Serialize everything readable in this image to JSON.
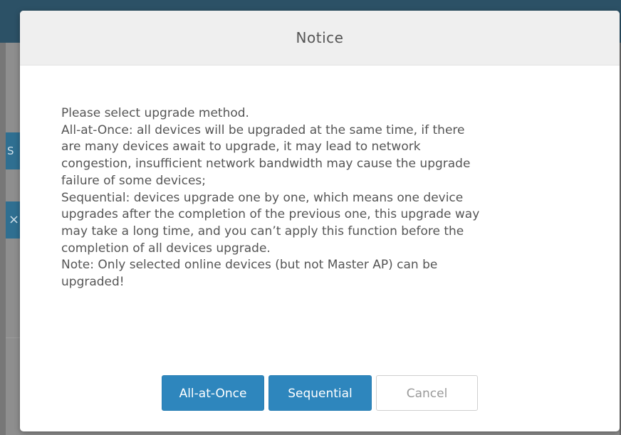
{
  "background": {
    "tab1_label": "S",
    "tab2_label": "×"
  },
  "dialog": {
    "title": "Notice",
    "body_lines": [
      "Please select upgrade method.",
      "All-at-Once: all devices will be upgraded at the same time, if there",
      "are many devices await to upgrade, it may lead to network",
      "congestion, insufficient network bandwidth may cause the upgrade",
      "failure of some devices;",
      "Sequential: devices upgrade one by one, which means one device",
      "upgrades after the completion of the previous one, this upgrade way",
      "may take a long time, and you can’t apply this function before the",
      "completion of all devices upgrade.",
      "Note: Only selected online devices (but not Master AP) can be",
      "upgraded!"
    ],
    "buttons": {
      "all_at_once": "All-at-Once",
      "sequential": "Sequential",
      "cancel": "Cancel"
    }
  },
  "colors": {
    "primary_button": "#2e86bd",
    "header_bg": "#efefef",
    "overlay": "#777777"
  }
}
